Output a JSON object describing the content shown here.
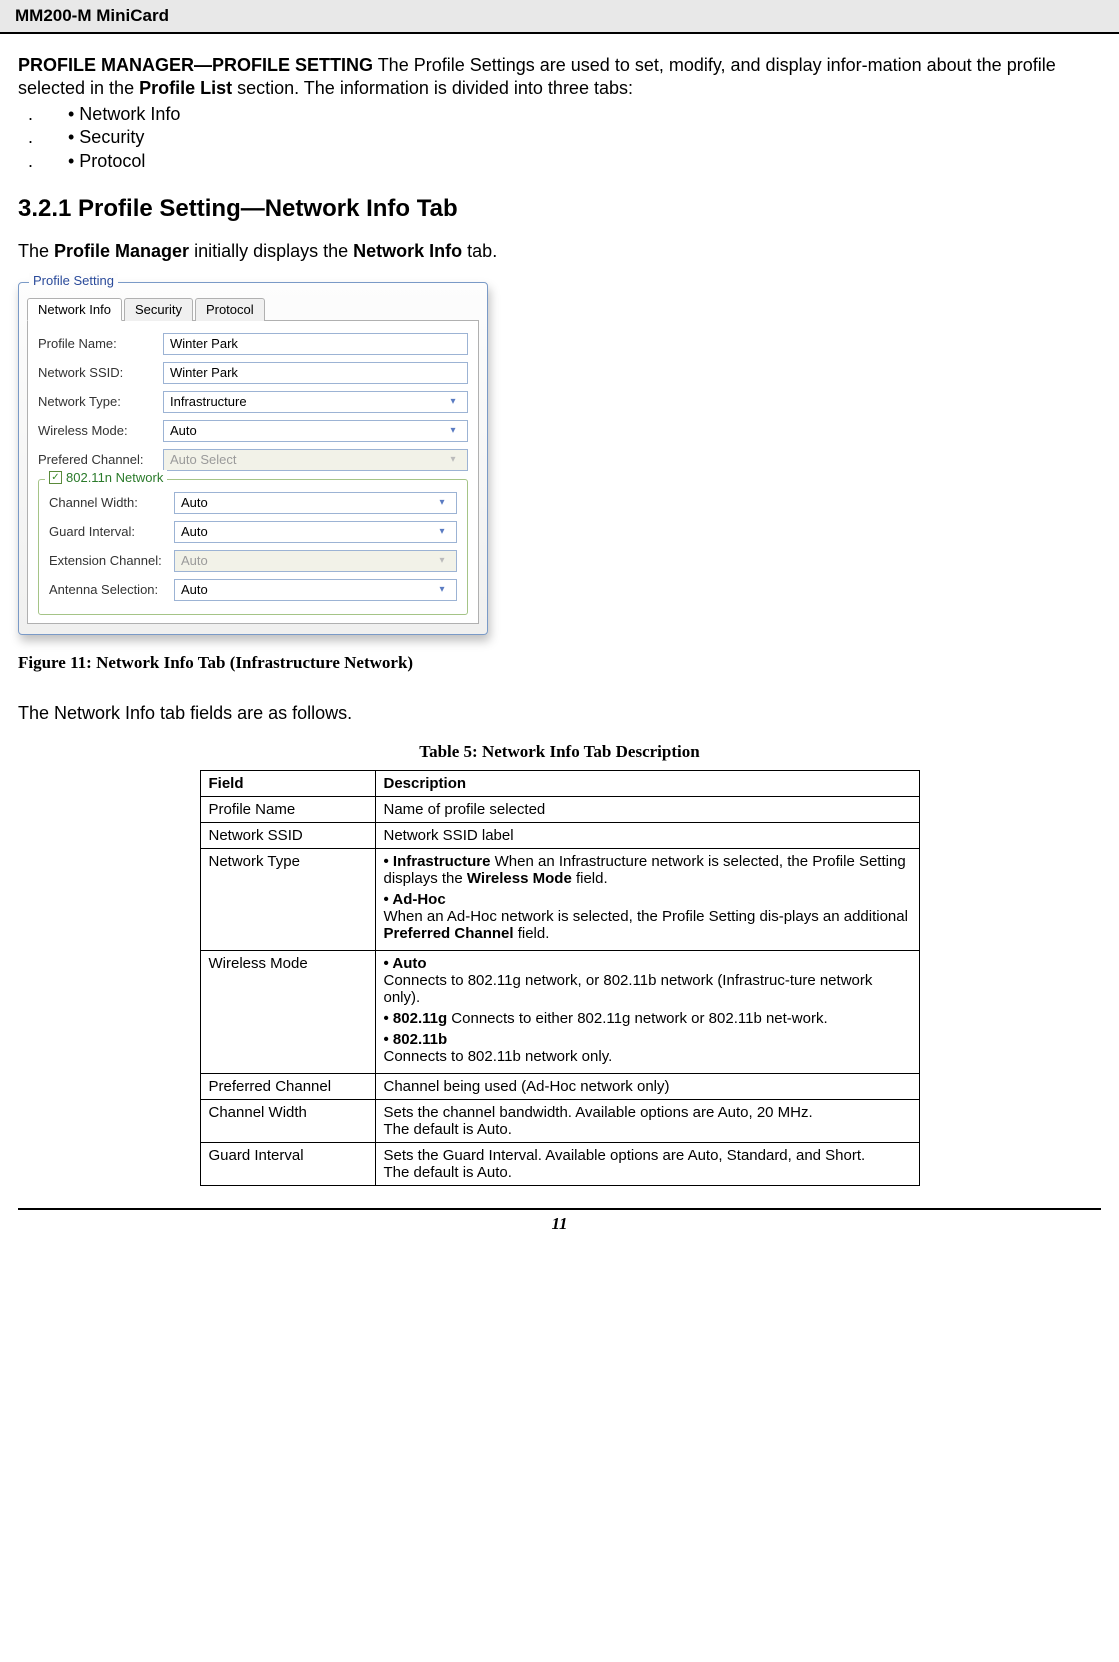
{
  "header": "MM200-M MiniCard",
  "intro": {
    "lead_bold": "PROFILE MANAGER—PROFILE SETTING",
    "lead_rest": " The Profile Settings are used to set, modify, and display infor-mation about the profile selected in the ",
    "lead_bold2": "Profile List",
    "lead_rest2": " section. The information is divided into three tabs:"
  },
  "bullets": [
    "• Network Info",
    "• Security",
    "• Protocol"
  ],
  "section_title": "3.2.1 Profile Setting—Network Info Tab",
  "para1_pre": "The ",
  "para1_b1": "Profile Manager",
  "para1_mid": " initially displays the ",
  "para1_b2": "Network Info",
  "para1_post": " tab.",
  "ui": {
    "group_caption": "Profile Setting",
    "tabs": [
      "Network Info",
      "Security",
      "Protocol"
    ],
    "fields": {
      "profile_name_label": "Profile Name:",
      "profile_name_value": "Winter Park",
      "ssid_label": "Network SSID:",
      "ssid_value": "Winter Park",
      "net_type_label": "Network Type:",
      "net_type_value": "Infrastructure",
      "wireless_mode_label": "Wireless Mode:",
      "wireless_mode_value": "Auto",
      "pref_channel_label": "Prefered Channel:",
      "pref_channel_value": "Auto Select",
      "inner_caption": "802.11n Network",
      "channel_width_label": "Channel Width:",
      "channel_width_value": "Auto",
      "guard_label": "Guard Interval:",
      "guard_value": "Auto",
      "ext_label": "Extension Channel:",
      "ext_value": "Auto",
      "antenna_label": "Antenna Selection:",
      "antenna_value": "Auto"
    }
  },
  "figure_caption": "Figure 11: Network Info Tab (Infrastructure Network)",
  "para2": "The Network Info tab fields are as follows.",
  "table_caption": "Table 5: Network Info Tab Description",
  "table": {
    "head_field": "Field",
    "head_desc": "Description",
    "rows": [
      {
        "field": "Profile Name",
        "desc_plain": "Name of profile selected"
      },
      {
        "field": "Network SSID",
        "desc_plain": "Network SSID label"
      },
      {
        "field": "Network Type",
        "blocks": [
          {
            "b": "• Infrastructure",
            "t": " When an Infrastructure network is selected, the Profile Setting displays the ",
            "b2": "Wireless Mode",
            "t2": " field."
          },
          {
            "b": "• Ad-Hoc",
            "nl": true,
            "t": "When an Ad-Hoc network is selected, the Profile Setting dis-plays an additional ",
            "b2": "Preferred Channel",
            "t2": " field."
          }
        ]
      },
      {
        "field": "Wireless Mode",
        "blocks": [
          {
            "b": "• Auto",
            "nl": true,
            "t": "Connects to 802.11g network, or 802.11b network (Infrastruc-ture network only)."
          },
          {
            "b": "• 802.11g",
            "t": " Connects to either 802.11g network or 802.11b net-work."
          },
          {
            "b": "• 802.11b",
            "nl": true,
            "t": "Connects to 802.11b network only."
          }
        ]
      },
      {
        "field": "Preferred Channel",
        "desc_plain": "Channel being used (Ad-Hoc network only)"
      },
      {
        "field": "Channel Width",
        "desc_lines": [
          "Sets the channel bandwidth. Available options are Auto, 20 MHz.",
          "The default is Auto."
        ]
      },
      {
        "field": "Guard Interval",
        "desc_lines": [
          "Sets the Guard Interval. Available options are Auto, Standard, and Short.",
          "The default is Auto."
        ]
      }
    ]
  },
  "page_number": "11"
}
